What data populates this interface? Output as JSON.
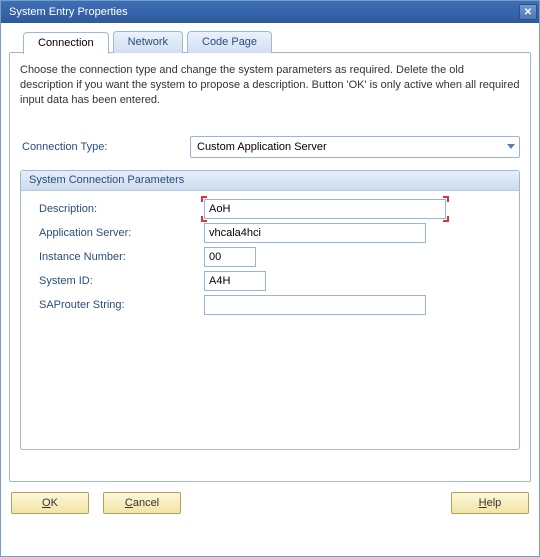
{
  "window": {
    "title": "System Entry Properties"
  },
  "tabs": {
    "connection": "Connection",
    "network": "Network",
    "codepage": "Code Page"
  },
  "intro": "Choose the connection type and change the system parameters as required. Delete the old description if you want the system to propose a description. Button 'OK' is only active when all required input data has been entered.",
  "connType": {
    "label": "Connection Type:",
    "value": "Custom Application Server"
  },
  "group": {
    "title": "System Connection Parameters",
    "description_label": "Description:",
    "description_value": "AoH",
    "appserver_label": "Application Server:",
    "appserver_value": "vhcala4hci",
    "instance_label": "Instance Number:",
    "instance_value": "00",
    "sysid_label": "System ID:",
    "sysid_value": "A4H",
    "saprouter_label": "SAProuter String:",
    "saprouter_value": ""
  },
  "buttons": {
    "ok_pre": "O",
    "ok_rest": "K",
    "cancel_pre": "C",
    "cancel_rest": "ancel",
    "help_pre": "H",
    "help_rest": "elp"
  }
}
